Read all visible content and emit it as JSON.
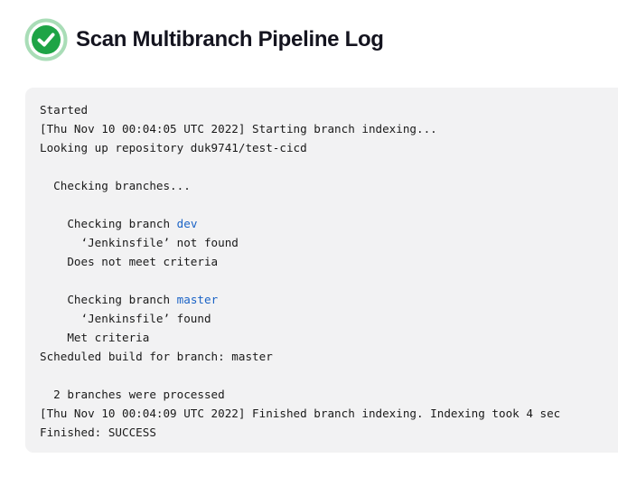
{
  "header": {
    "title": "Scan Multibranch Pipeline Log",
    "status_icon": "success-check-icon",
    "status_color": "#1ea446"
  },
  "log": {
    "line_01": "Started",
    "line_02": "[Thu Nov 10 00:04:05 UTC 2022] Starting branch indexing...",
    "line_03": "Looking up repository duk9741/test-cicd",
    "line_04": "",
    "line_05": "  Checking branches...",
    "line_06": "",
    "line_07_prefix": "    Checking branch ",
    "line_07_link": "dev",
    "line_08": "      ‘Jenkinsfile’ not found",
    "line_09": "    Does not meet criteria",
    "line_10": "",
    "line_11_prefix": "    Checking branch ",
    "line_11_link": "master",
    "line_12": "      ‘Jenkinsfile’ found",
    "line_13": "    Met criteria",
    "line_14": "Scheduled build for branch: master",
    "line_15": "",
    "line_16": "  2 branches were processed",
    "line_17": "[Thu Nov 10 00:04:09 UTC 2022] Finished branch indexing. Indexing took 4 sec",
    "line_18": "Finished: SUCCESS"
  },
  "colors": {
    "link": "#1b63c6",
    "console_background": "#f2f2f3"
  }
}
